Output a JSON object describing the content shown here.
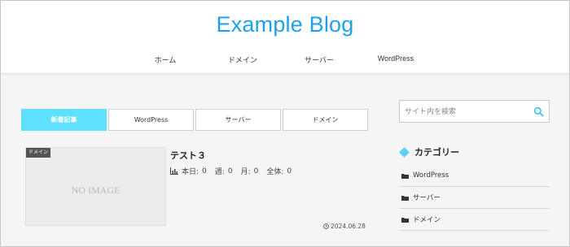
{
  "header": {
    "site_title": "Example Blog",
    "nav": [
      "ホーム",
      "ドメイン",
      "サーバー",
      "WordPress"
    ]
  },
  "tabs": [
    {
      "label": "新着記事",
      "active": true
    },
    {
      "label": "WordPress",
      "active": false
    },
    {
      "label": "サーバー",
      "active": false
    },
    {
      "label": "ドメイン",
      "active": false
    }
  ],
  "post": {
    "category": "ドメイン",
    "thumbnail_text": "NO IMAGE",
    "title": "テスト３",
    "views": {
      "today_label": "本日:",
      "today": "0",
      "week_label": "週:",
      "week": "0",
      "month_label": "月:",
      "month": "0",
      "total_label": "全体:",
      "total": "0"
    },
    "date": "2024.06.28"
  },
  "sidebar": {
    "search_placeholder": "サイト内を検索",
    "category_heading": "カテゴリー",
    "categories": [
      "WordPress",
      "サーバー",
      "ドメイン"
    ]
  },
  "colors": {
    "accent": "#1fa0ea",
    "active_tab": "#5ee1ff",
    "diamond": "#5fd0f5"
  }
}
